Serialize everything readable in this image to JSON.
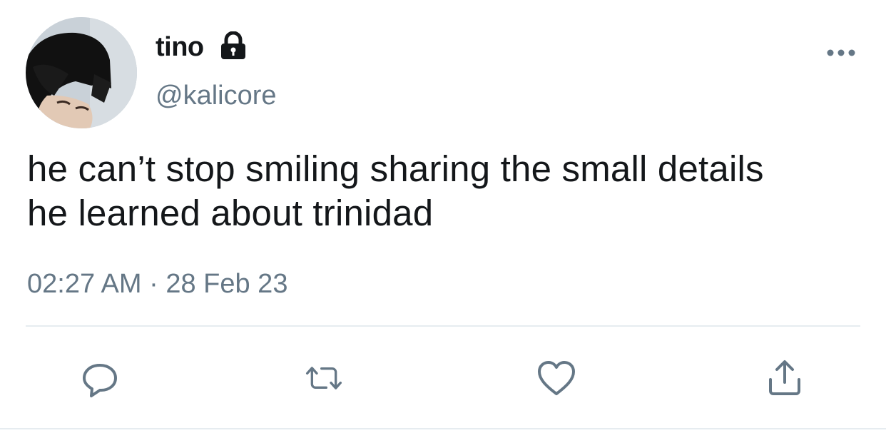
{
  "tweet": {
    "author": {
      "display_name": "tino",
      "handle": "@kalicore",
      "protected_icon": "lock-icon",
      "avatar_icon": "avatar"
    },
    "text_line_1": "he can’t stop smiling sharing the small details",
    "text_line_2": "he learned about trinidad",
    "timestamp": "02:27 AM · 28 Feb 23",
    "more_icon": "more-horizontal-icon"
  },
  "actions": {
    "reply_icon": "reply-icon",
    "retweet_icon": "retweet-icon",
    "like_icon": "heart-icon",
    "share_icon": "share-icon"
  },
  "colors": {
    "primary_text": "#14171a",
    "secondary_text": "#657786",
    "divider": "#e6ecf0"
  }
}
